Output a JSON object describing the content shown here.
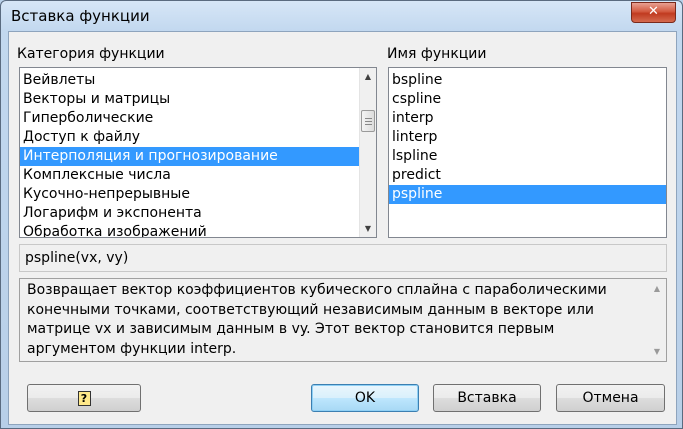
{
  "window": {
    "title": "Вставка функции",
    "close_glyph": "✕"
  },
  "category": {
    "label": "Категория функции",
    "items": [
      "Вейвлеты",
      "Векторы и матрицы",
      "Гиперболические",
      "Доступ к файлу",
      "Интерполяция и прогнозирование",
      "Комплексные числа",
      "Кусочно-непрерывные",
      "Логарифм и экспонента",
      "Обработка изображений"
    ],
    "selected_index": 4
  },
  "function": {
    "label": "Имя функции",
    "items": [
      "bspline",
      "cspline",
      "interp",
      "linterp",
      "lspline",
      "predict",
      "pspline"
    ],
    "selected_index": 6
  },
  "signature": "pspline(vx, vy)",
  "description": "Возвращает вектор коэффициентов кубического сплайна с параболическими конечными точками, соответствующий независимым данным в векторе или матрице vx и зависимым данным в vy. Этот вектор становится первым аргументом функции interp.",
  "buttons": {
    "help": "?",
    "ok": "OK",
    "insert": "Вставка",
    "cancel": "Отмена"
  },
  "icons": {
    "scroll_up": "▲",
    "scroll_down": "▼",
    "help": "help-icon"
  },
  "colors": {
    "selection": "#3399ff",
    "close": "#c7402a"
  }
}
